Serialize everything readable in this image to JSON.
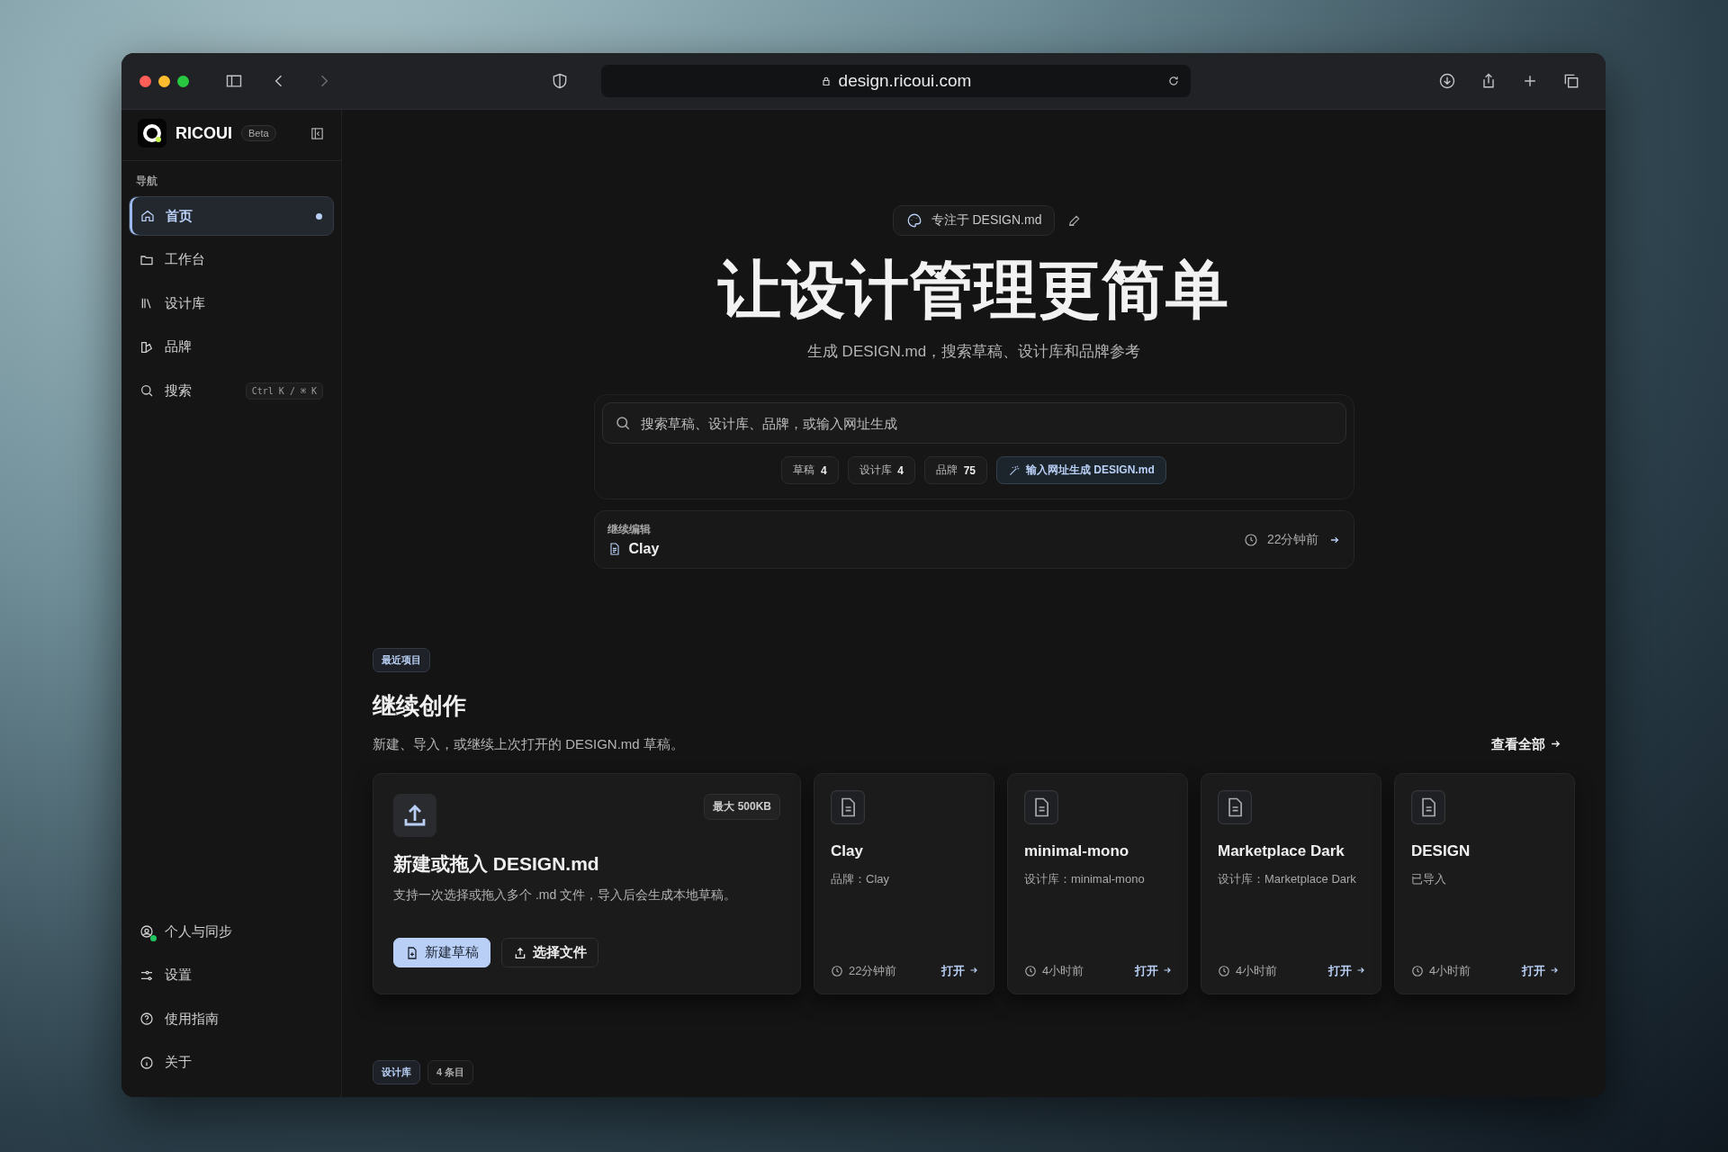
{
  "browser": {
    "url": "design.ricoui.com"
  },
  "sidebar": {
    "brand": "RICOUI",
    "badge": "Beta",
    "section_label": "导航",
    "nav": [
      {
        "label": "首页",
        "selected": true
      },
      {
        "label": "工作台",
        "selected": false
      },
      {
        "label": "设计库",
        "selected": false
      },
      {
        "label": "品牌",
        "selected": false
      },
      {
        "label": "搜索",
        "selected": false,
        "shortcut": "Ctrl K / ⌘ K"
      }
    ],
    "footer": [
      {
        "label": "个人与同步",
        "online": true
      },
      {
        "label": "设置",
        "online": false
      },
      {
        "label": "使用指南",
        "online": false
      },
      {
        "label": "关于",
        "online": false
      }
    ]
  },
  "hero": {
    "chip": "专注于 DESIGN.md",
    "title": "让设计管理更简单",
    "subtitle": "生成 DESIGN.md，搜索草稿、设计库和品牌参考",
    "search": {
      "placeholder": "搜索草稿、设计库、品牌，或输入网址生成"
    },
    "filters": [
      {
        "kind": "count",
        "label": "草稿",
        "count": "4"
      },
      {
        "kind": "count",
        "label": "设计库",
        "count": "4"
      },
      {
        "kind": "count",
        "label": "品牌",
        "count": "75"
      },
      {
        "kind": "action",
        "label": "输入网址生成 DESIGN.md"
      }
    ],
    "resume": {
      "label": "继续编辑",
      "title": "Clay",
      "time": "22分钟前"
    }
  },
  "recent": {
    "tag": "最近项目",
    "heading": "继续创作",
    "description": "新建、导入，或继续上次打开的 DESIGN.md 草稿。",
    "view_all": "查看全部",
    "upload": {
      "limit": "最大 500KB",
      "title": "新建或拖入 DESIGN.md",
      "description": "支持一次选择或拖入多个 .md 文件，导入后会生成本地草稿。",
      "buttons": [
        {
          "kind": "primary",
          "label": "新建草稿"
        },
        {
          "kind": "secondary",
          "label": "选择文件"
        }
      ]
    },
    "cards": [
      {
        "title": "Clay",
        "meta": "品牌：Clay",
        "time": "22分钟前",
        "action": "打开"
      },
      {
        "title": "minimal-mono",
        "meta": "设计库：minimal-mono",
        "time": "4小时前",
        "action": "打开"
      },
      {
        "title": "Marketplace Dark",
        "meta": "设计库：Marketplace Dark",
        "time": "4小时前",
        "action": "打开"
      },
      {
        "title": "DESIGN",
        "meta": "已导入",
        "time": "4小时前",
        "action": "打开"
      }
    ]
  },
  "library": {
    "tag": "设计库",
    "count": "4 条目"
  }
}
